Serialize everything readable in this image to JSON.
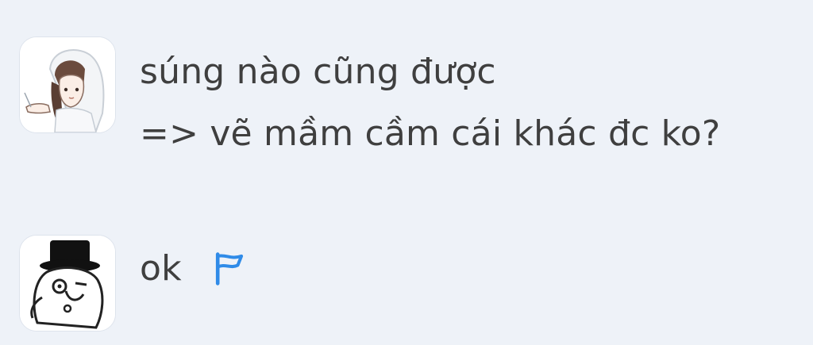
{
  "messages": [
    {
      "avatar": "girl-veil-avatar",
      "lines": [
        "súng nào cũng được",
        "=> vẽ mầm cầm cái khác đc ko?"
      ]
    },
    {
      "avatar": "top-hat-meme-avatar",
      "text": "ok",
      "icon": "flag-icon"
    }
  ],
  "colors": {
    "background": "#eef2f8",
    "text": "#3f3f3f",
    "flag": "#2f8be8"
  }
}
